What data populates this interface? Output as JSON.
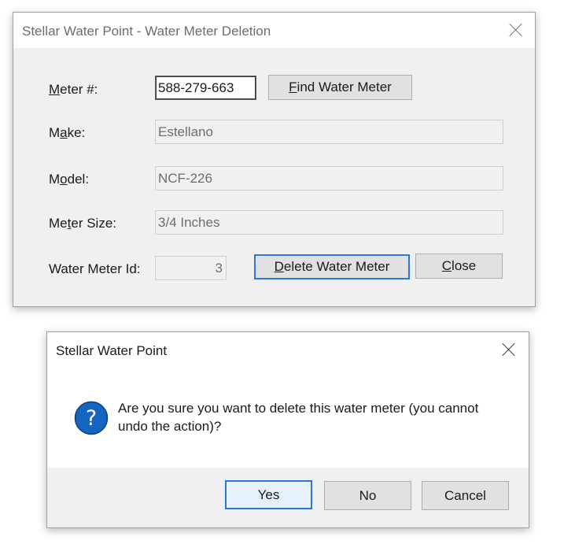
{
  "main_window": {
    "title": "Stellar Water Point - Water Meter Deletion",
    "meter_number_label": "Meter #:",
    "meter_number_value": "588-279-663",
    "find_button": "Find Water Meter",
    "make_label": "Make:",
    "make_value": "Estellano",
    "model_label": "Model:",
    "model_value": "NCF-226",
    "meter_size_label": "Meter Size:",
    "meter_size_value": "3/4 Inches",
    "water_meter_id_label": "Water Meter Id:",
    "water_meter_id_value": "3",
    "delete_button": "Delete Water Meter",
    "close_button": "Close"
  },
  "confirm_dialog": {
    "title": "Stellar Water Point",
    "icon": "question-icon",
    "message_line1": "Are you sure you want to delete this water meter (you cannot",
    "message_line2": "undo the action)?",
    "yes_button": "Yes",
    "no_button": "No",
    "cancel_button": "Cancel"
  },
  "colors": {
    "focus_accent": "#2a78d6",
    "question_icon": "#1565c0"
  }
}
